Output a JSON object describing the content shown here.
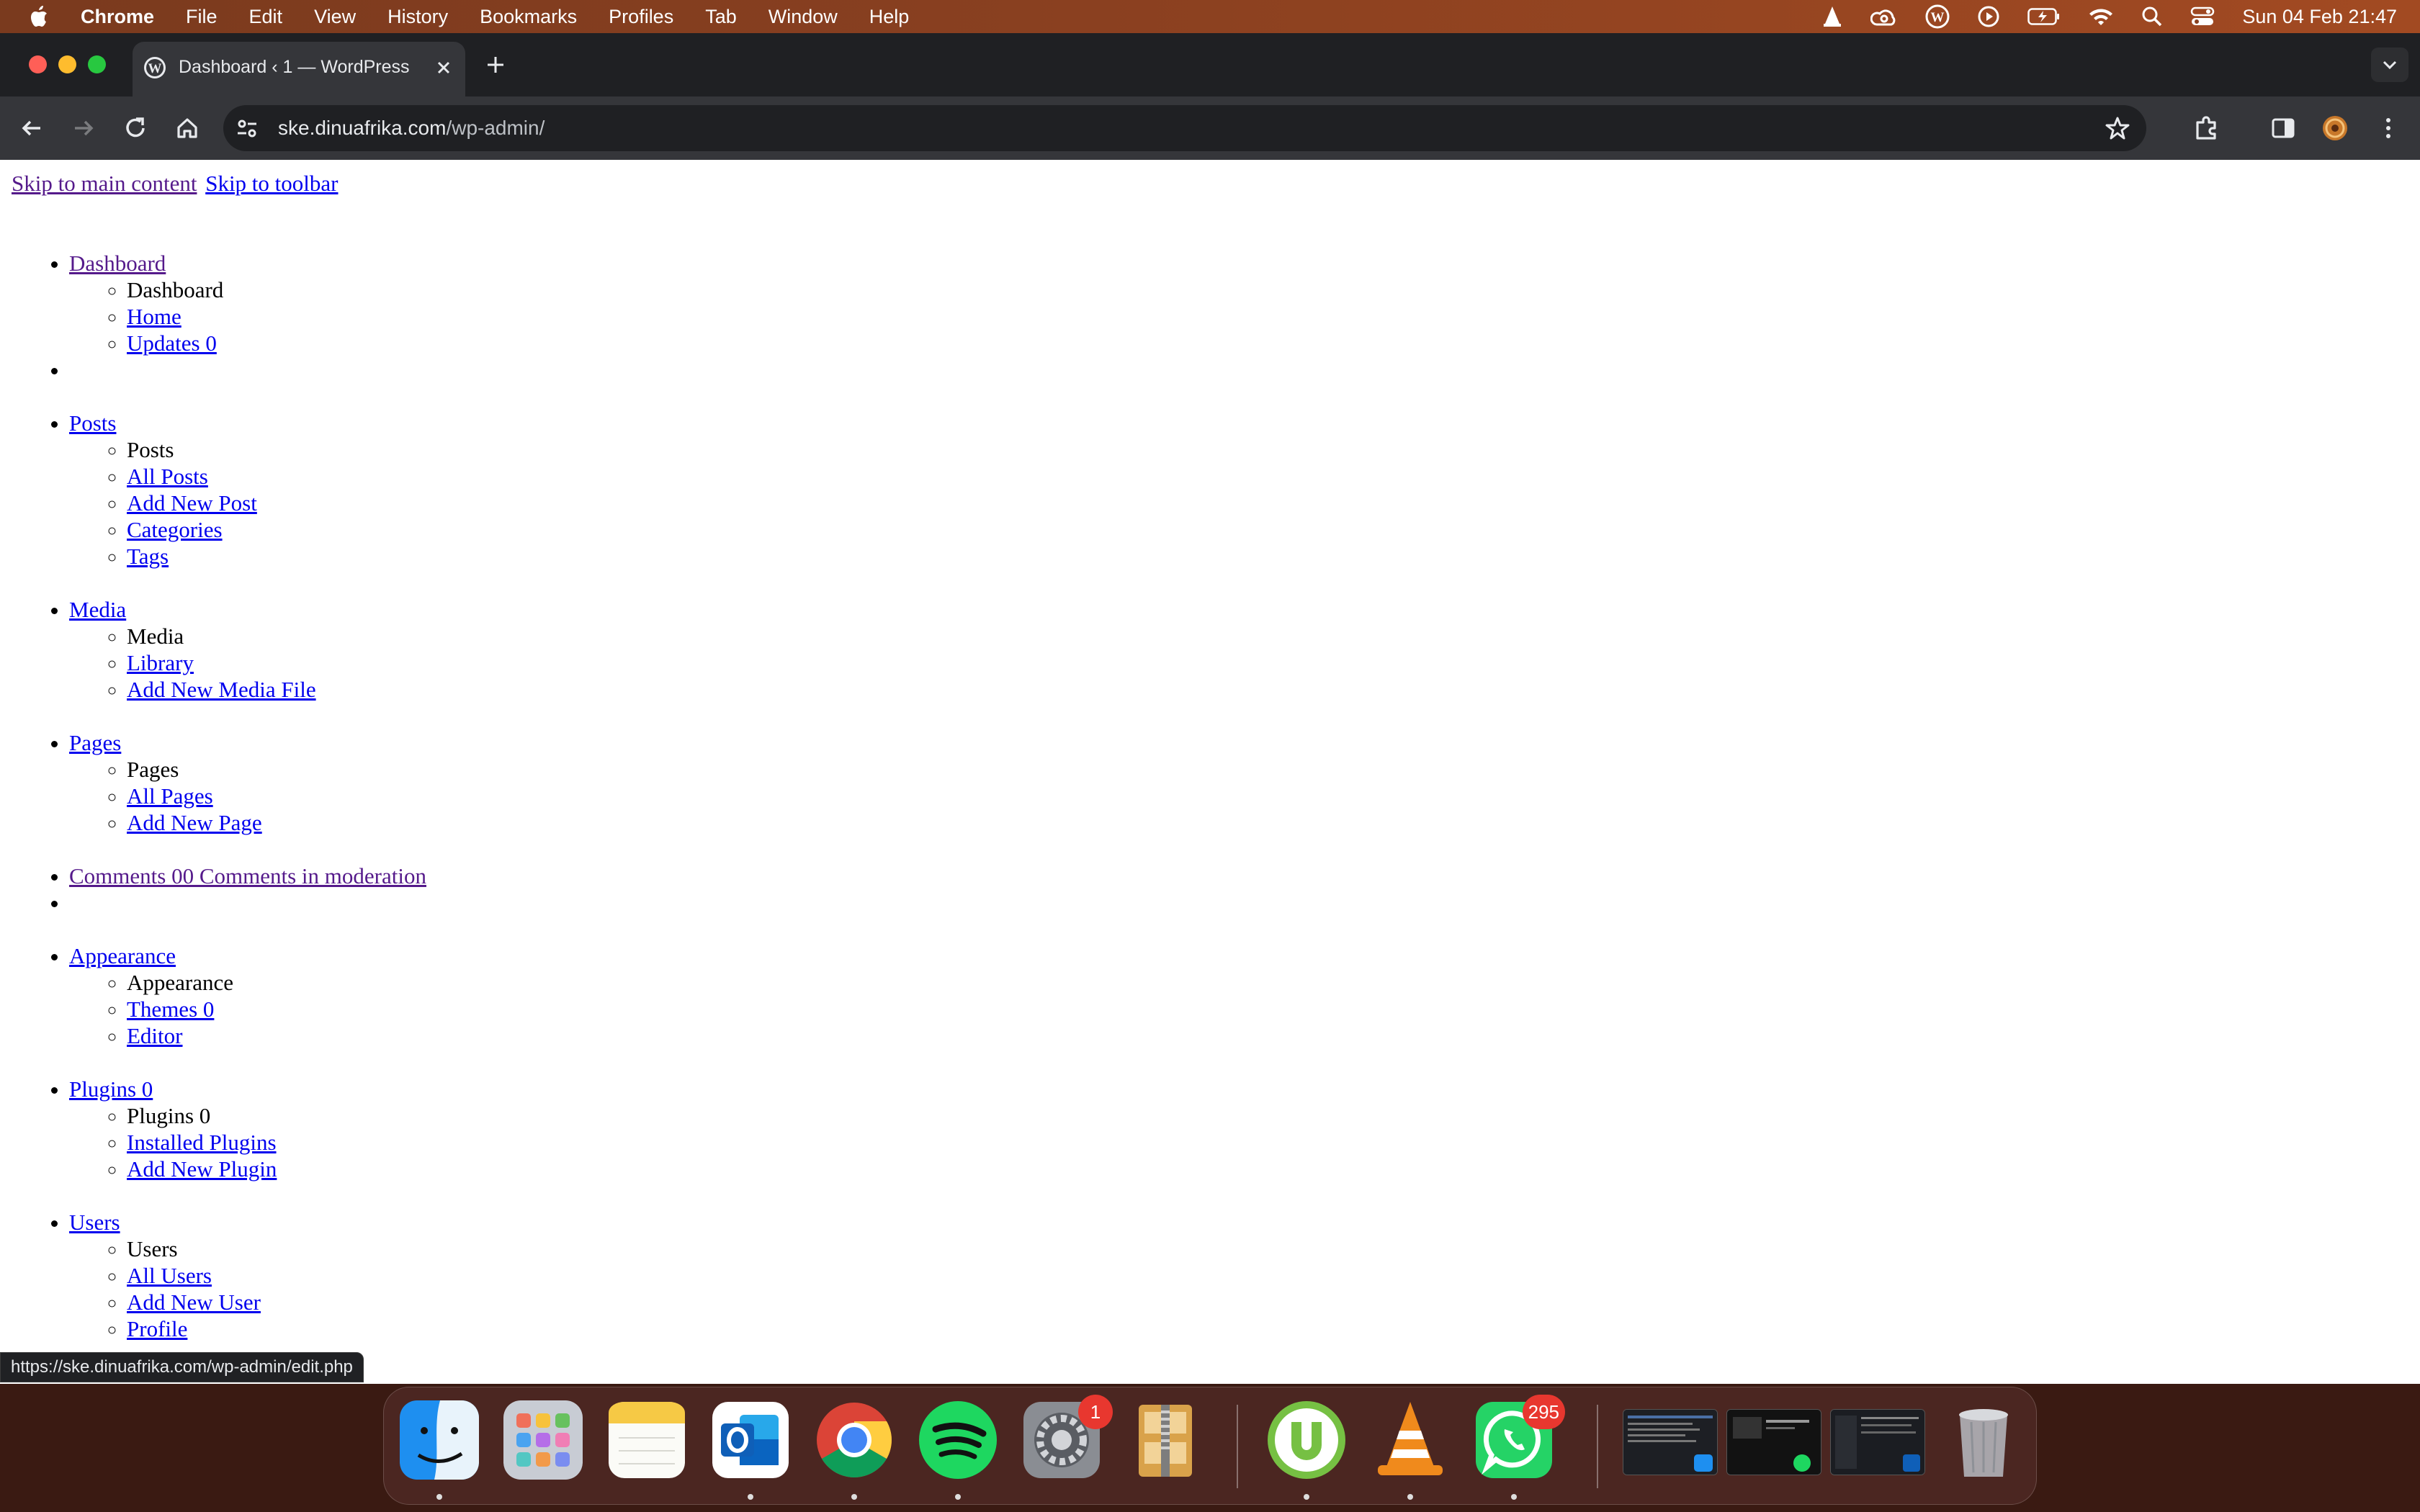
{
  "menubar": {
    "app_name": "Chrome",
    "items": [
      "File",
      "Edit",
      "View",
      "History",
      "Bookmarks",
      "Profiles",
      "Tab",
      "Window",
      "Help"
    ],
    "clock": "Sun 04 Feb  21:47"
  },
  "browser": {
    "tab_title": "Dashboard ‹ 1 — WordPress",
    "url_host": "ske.dinuafrika.com",
    "url_path": "/wp-admin/"
  },
  "page": {
    "skip_links": [
      "Skip to main content",
      "Skip to toolbar"
    ],
    "menu": {
      "dashboard": {
        "link": "Dashboard",
        "heading": "Dashboard",
        "sub": [
          "Home",
          "Updates 0"
        ]
      },
      "posts": {
        "link": "Posts",
        "heading": "Posts",
        "sub": [
          "All Posts",
          "Add New Post",
          "Categories",
          "Tags"
        ]
      },
      "media": {
        "link": "Media",
        "heading": "Media",
        "sub": [
          "Library",
          "Add New Media File"
        ]
      },
      "pages": {
        "link": "Pages",
        "heading": "Pages",
        "sub": [
          "All Pages",
          "Add New Page"
        ]
      },
      "comments": {
        "link": "Comments 00 Comments in moderation"
      },
      "appearance": {
        "link": "Appearance",
        "heading": "Appearance",
        "sub": [
          "Themes 0",
          "Editor"
        ]
      },
      "plugins": {
        "link": "Plugins 0",
        "heading": "Plugins 0",
        "sub": [
          "Installed Plugins",
          "Add New Plugin"
        ]
      },
      "users": {
        "link": "Users",
        "heading": "Users",
        "sub": [
          "All Users",
          "Add New User",
          "Profile"
        ]
      }
    },
    "status_url": "https://ske.dinuafrika.com/wp-admin/edit.php"
  },
  "dock": {
    "apps": [
      "Finder",
      "Launchpad",
      "Notes",
      "Outlook",
      "Chrome",
      "Spotify",
      "System Settings",
      "Archive Utility",
      "uTorrent",
      "VLC",
      "WhatsApp",
      "Trash"
    ],
    "badges": {
      "system_settings": "1",
      "whatsapp": "295"
    }
  },
  "colors": {
    "link": "#0000ee",
    "visited_link": "#551a8b",
    "menubar": "#8a4020",
    "chrome_dark": "#35363a"
  }
}
